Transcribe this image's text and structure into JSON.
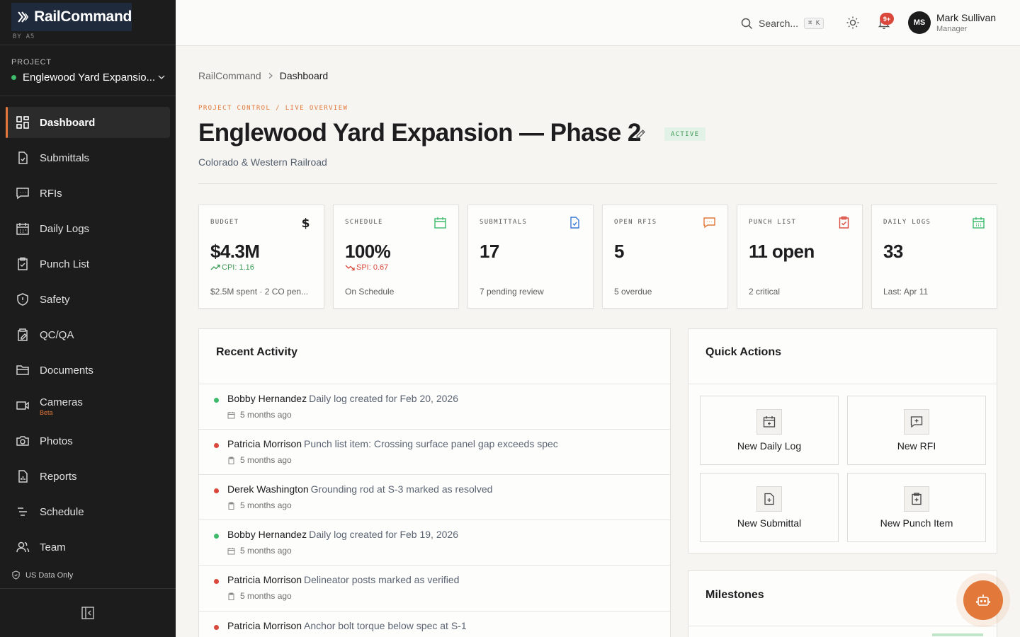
{
  "brand": {
    "name": "RailCommand",
    "sub": "BY A5"
  },
  "project": {
    "label": "PROJECT",
    "name": "Englewood Yard Expansio..."
  },
  "nav": [
    {
      "label": "Dashboard",
      "icon": "dashboard-icon"
    },
    {
      "label": "Submittals",
      "icon": "file-check-icon"
    },
    {
      "label": "RFIs",
      "icon": "message-square-icon"
    },
    {
      "label": "Daily Logs",
      "icon": "calendar-icon"
    },
    {
      "label": "Punch List",
      "icon": "clipboard-icon"
    },
    {
      "label": "Safety",
      "icon": "shield-icon"
    },
    {
      "label": "QC/QA",
      "icon": "clipboard-edit-icon"
    },
    {
      "label": "Documents",
      "icon": "folder-icon"
    },
    {
      "label": "Cameras",
      "icon": "video-icon",
      "badge": "Beta"
    },
    {
      "label": "Photos",
      "icon": "camera-icon"
    },
    {
      "label": "Reports",
      "icon": "report-icon"
    },
    {
      "label": "Schedule",
      "icon": "list-icon"
    },
    {
      "label": "Team",
      "icon": "users-icon"
    }
  ],
  "sidebar_footer": {
    "data_notice": "US Data Only"
  },
  "header": {
    "search_placeholder": "Search...",
    "search_shortcut": "⌘ K",
    "notifications_badge": "9+",
    "user": {
      "initials": "MS",
      "name": "Mark Sullivan",
      "role": "Manager"
    }
  },
  "breadcrumb": {
    "root": "RailCommand",
    "current": "Dashboard"
  },
  "page": {
    "eyebrow": "PROJECT CONTROL / LIVE OVERVIEW",
    "title": "Englewood Yard Expansion — Phase 2",
    "status": "ACTIVE",
    "subtitle": "Colorado & Western Railroad"
  },
  "kpis": [
    {
      "label": "BUDGET",
      "value": "$4.3M",
      "trend": "CPI: 1.16",
      "trend_color": "#3e9a56",
      "foot": "$2.5M spent · 2 CO pen...",
      "icon": "dollar-icon"
    },
    {
      "label": "SCHEDULE",
      "value": "100%",
      "trend": "SPI: 0.67",
      "trend_color": "#d9483b",
      "foot": "On Schedule",
      "icon": "calendar-icon"
    },
    {
      "label": "SUBMITTALS",
      "value": "17",
      "foot": "7 pending review",
      "icon": "file-check-icon"
    },
    {
      "label": "OPEN RFIS",
      "value": "5",
      "foot": "5 overdue",
      "icon": "message-square-icon"
    },
    {
      "label": "PUNCH LIST",
      "value": "11 open",
      "foot": "2 critical",
      "icon": "clipboard-check-icon"
    },
    {
      "label": "DAILY LOGS",
      "value": "33",
      "foot": "Last: Apr 11",
      "icon": "calendar-grid-icon"
    }
  ],
  "activity": {
    "title": "Recent Activity",
    "items": [
      {
        "user": "Bobby Hernandez",
        "text": "Daily log created for Feb 20, 2026",
        "time": "5 months ago",
        "dot": "#3dbb6b",
        "icon": "calendar-icon"
      },
      {
        "user": "Patricia Morrison",
        "text": "Punch list item: Crossing surface panel gap exceeds spec",
        "time": "5 months ago",
        "dot": "#d9483b",
        "icon": "clipboard-icon"
      },
      {
        "user": "Derek Washington",
        "text": "Grounding rod at S-3 marked as resolved",
        "time": "5 months ago",
        "dot": "#d9483b",
        "icon": "clipboard-icon"
      },
      {
        "user": "Bobby Hernandez",
        "text": "Daily log created for Feb 19, 2026",
        "time": "5 months ago",
        "dot": "#3dbb6b",
        "icon": "calendar-icon"
      },
      {
        "user": "Patricia Morrison",
        "text": "Delineator posts marked as verified",
        "time": "5 months ago",
        "dot": "#d9483b",
        "icon": "clipboard-icon"
      },
      {
        "user": "Patricia Morrison",
        "text": "Anchor bolt torque below spec at S-1",
        "time": "",
        "dot": "#d9483b",
        "icon": "clipboard-icon"
      }
    ]
  },
  "quick_actions": {
    "title": "Quick Actions",
    "items": [
      {
        "label": "New Daily Log",
        "icon": "calendar-plus-icon"
      },
      {
        "label": "New RFI",
        "icon": "message-plus-icon"
      },
      {
        "label": "New Submittal",
        "icon": "file-plus-icon"
      },
      {
        "label": "New Punch Item",
        "icon": "clipboard-plus-icon"
      }
    ]
  },
  "milestones": {
    "title": "Milestones"
  },
  "colors": {
    "accent": "#e2783a",
    "sidebar_bg": "#1c1c1c",
    "success": "#3dbb6b",
    "danger": "#d9483b"
  }
}
